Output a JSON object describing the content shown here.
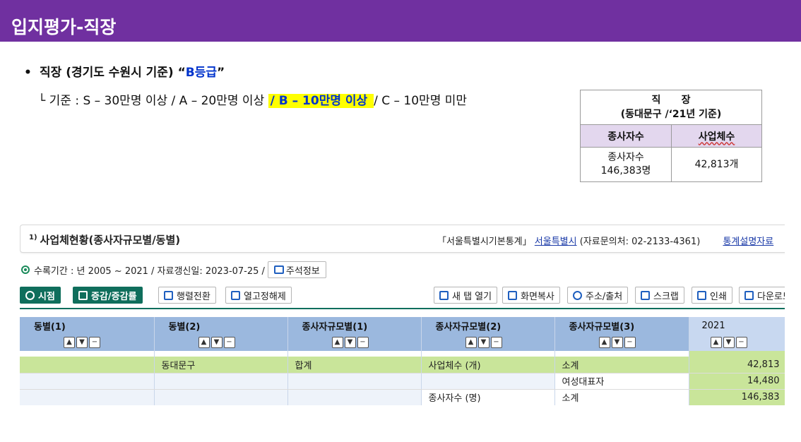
{
  "slide": {
    "title": "입지평가-직장",
    "bullet_symbol": "•",
    "bullet_text": "직장 (경기도 수원시 기준) “",
    "bullet_grade": "B등급",
    "bullet_end": "”",
    "criteria_prefix": "└ 기준 : S – 30만명 이상 / A – 20만명 이상 ",
    "criteria_highlight": "/ B – 10만명 이상 ",
    "criteria_suffix": "/ C – 10만명 미만"
  },
  "summary_table": {
    "title_line1": "직      장",
    "title_line2": "(동대문구 /‘21년 기준)",
    "col1_header": "종사자수",
    "col2_header": "사업체수",
    "col1_value_line1": "종사자수",
    "col1_value_line2": "146,383명",
    "col2_value": "42,813개"
  },
  "stats_panel": {
    "footnote": "1)",
    "title": "사업체현황(종사자규모별/동별)",
    "source_label": "「서울특별시기본통계」",
    "source_org": "서울특별시",
    "source_contact": "(자료문의처: 02-2133-4361)",
    "explain_link": "통계설명자료",
    "period_text": "수록기간 : 년 2005 ~ 2021 / 자료갱신일: 2023-07-25 /",
    "note_button": "주석정보",
    "toolbar": {
      "time": "시점",
      "change": "증감/증감률",
      "transpose": "행렬전환",
      "unfix": "열고정해제",
      "new_tab": "새 탭 열기",
      "copy": "화면복사",
      "address": "주소/출처",
      "scrap": "스크랩",
      "print": "인쇄",
      "download": "다운로드"
    },
    "columns": [
      "동별(1)",
      "동별(2)",
      "종사자규모별(1)",
      "종사자규모별(2)",
      "종사자규모별(3)",
      "2021"
    ],
    "rows": [
      {
        "c1": "",
        "c2": "동대문구",
        "c3": "합계",
        "c4": "사업체수 (개)",
        "c5": "소계",
        "value": "42,813"
      },
      {
        "c1": "",
        "c2": "",
        "c3": "",
        "c4": "",
        "c5": "여성대표자",
        "value": "14,480"
      },
      {
        "c1": "",
        "c2": "",
        "c3": "",
        "c4": "종사자수 (명)",
        "c5": "소계",
        "value": "146,383"
      }
    ]
  }
}
